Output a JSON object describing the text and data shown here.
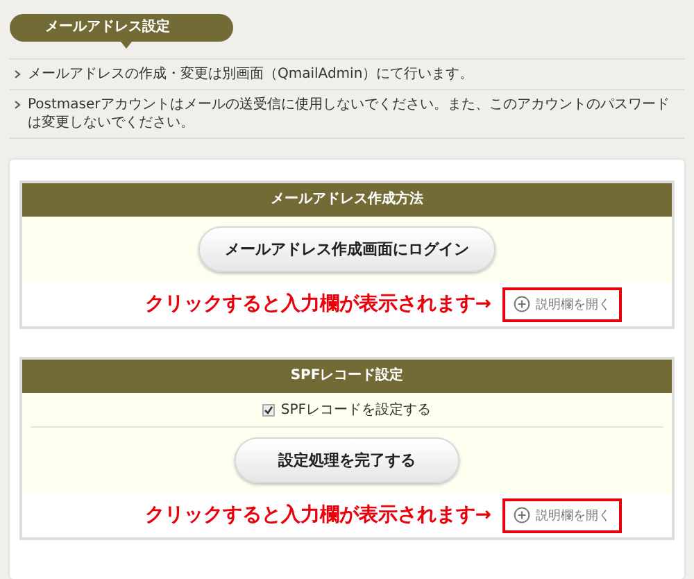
{
  "heading": "メールアドレス設定",
  "notes": [
    "メールアドレスの作成・変更は別画面（QmailAdmin）にて行います。",
    "Postmaserアカウントはメールの送受信に使用しないでください。また、このアカウントのパスワードは変更しないでください。"
  ],
  "sections": [
    {
      "title": "メールアドレス作成方法",
      "rows": [
        {
          "kind": "button",
          "label": "メールアドレス作成画面にログイン"
        }
      ],
      "annotation": "クリックすると入力欄が表示されます→",
      "toggle_link": "説明欄を開く"
    },
    {
      "title": "SPFレコード設定",
      "rows": [
        {
          "kind": "checkbox",
          "label": "SPFレコードを設定する",
          "checked": true
        },
        {
          "kind": "button",
          "label": "設定処理を完了する"
        }
      ],
      "annotation": "クリックすると入力欄が表示されます→",
      "toggle_link": "説明欄を開く"
    }
  ]
}
